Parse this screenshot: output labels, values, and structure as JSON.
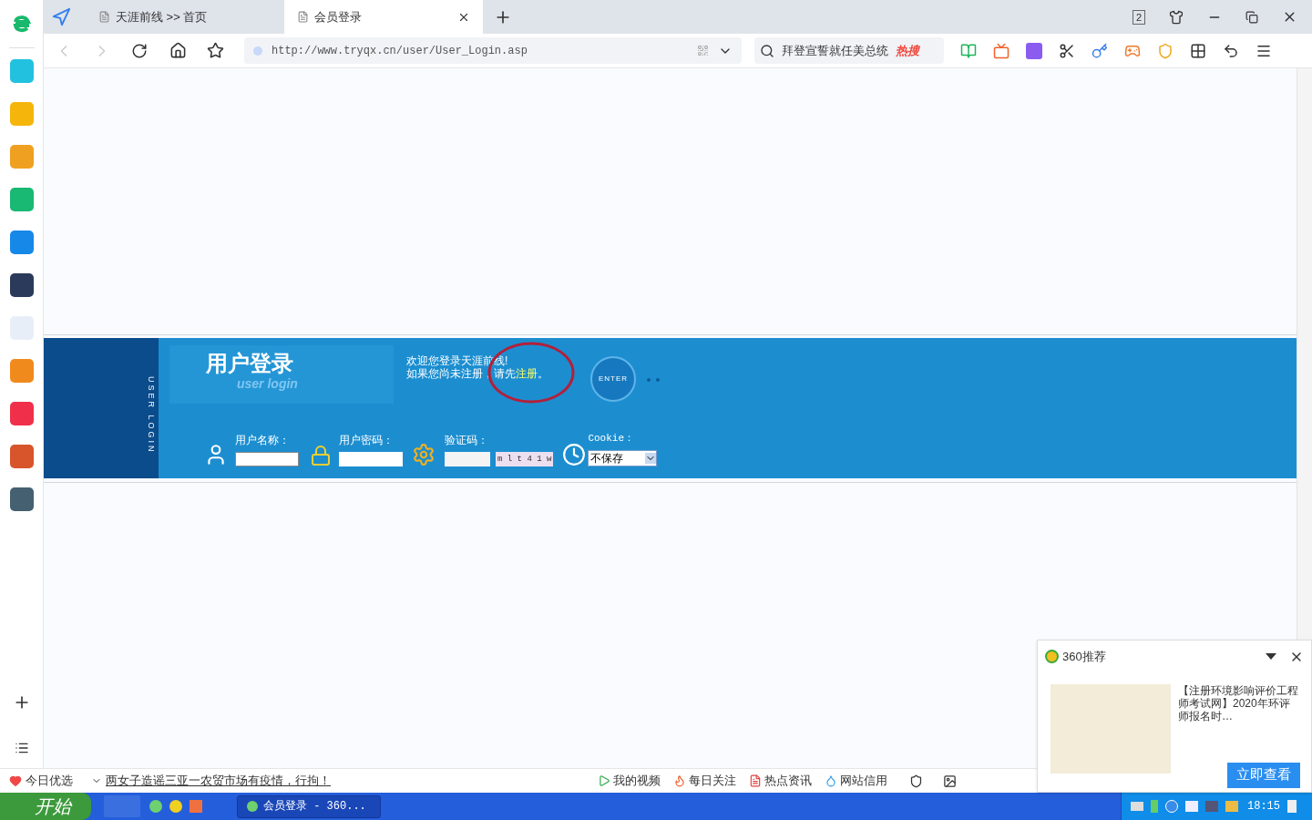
{
  "tabs": [
    {
      "label": "天涯前线 >> 首页",
      "selected": false
    },
    {
      "label": "会员登录",
      "selected": true
    }
  ],
  "tab_count": "2",
  "address_bar": {
    "url": "http://www.tryqx.cn/user/User_Login.asp"
  },
  "search": {
    "value": "拜登宣誓就任美总统",
    "badge": "热搜"
  },
  "login": {
    "title": "用户登录",
    "subtitle": "user login",
    "side_label": "USER LOGIN",
    "welcome": "欢迎您登录天涯前线!",
    "register_prompt": "如果您尚未注册，请先",
    "register_link": "注册",
    "register_suffix": "。",
    "enter_button": "ENTER",
    "fields": [
      {
        "kind": "user",
        "label": "用户名称："
      },
      {
        "kind": "password",
        "label": "用户密码："
      },
      {
        "kind": "captcha",
        "label": "验证码：",
        "captcha": "m l t 4 1 w"
      },
      {
        "kind": "select",
        "label": "Cookie：",
        "value": "不保存"
      }
    ]
  },
  "status_bar": {
    "today": "今日优选",
    "news": "两女子造谣三亚一农贸市场有疫情，行拘！",
    "items": [
      {
        "kind": "video",
        "label": "我的视频"
      },
      {
        "kind": "fire",
        "label": "每日关注"
      },
      {
        "kind": "news",
        "label": "热点资讯"
      },
      {
        "kind": "drop",
        "label": "网站信用"
      }
    ]
  },
  "taskbar": {
    "start": "开始",
    "windows": [
      {
        "label": "会员登录 - 360...",
        "selected": true
      }
    ],
    "clock": "18:15"
  },
  "popup": {
    "title": "360推荐",
    "text": "【注册环境影响评价工程师考试网】2020年环评师报名时…",
    "button": "立即查看"
  }
}
